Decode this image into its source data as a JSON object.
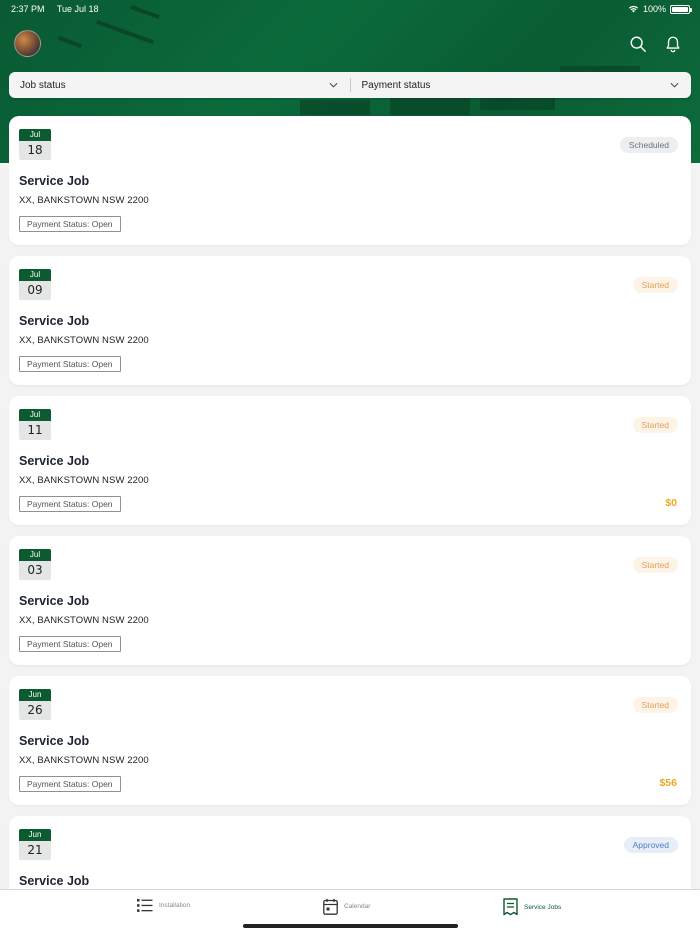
{
  "status_bar": {
    "time": "2:37 PM",
    "date": "Tue Jul 18",
    "battery": "100%"
  },
  "filters": {
    "job_status": "Job status",
    "payment_status": "Payment status"
  },
  "jobs": [
    {
      "month": "Jul",
      "day": "18",
      "status": "Scheduled",
      "status_color": "#6b7280",
      "status_bg": "#eceef0",
      "title": "Service Job",
      "address": "XX, BANKSTOWN NSW 2200",
      "payment": "Payment Status: Open",
      "amount": ""
    },
    {
      "month": "Jul",
      "day": "09",
      "status": "Started",
      "status_color": "#e0a05a",
      "status_bg": "#fdf3e6",
      "title": "Service Job",
      "address": "XX, BANKSTOWN NSW 2200",
      "payment": "Payment Status: Open",
      "amount": ""
    },
    {
      "month": "Jul",
      "day": "11",
      "status": "Started",
      "status_color": "#e0a05a",
      "status_bg": "#fdf3e6",
      "title": "Service Job",
      "address": "XX, BANKSTOWN NSW 2200",
      "payment": "Payment Status: Open",
      "amount": "$0"
    },
    {
      "month": "Jul",
      "day": "03",
      "status": "Started",
      "status_color": "#e0a05a",
      "status_bg": "#fdf3e6",
      "title": "Service Job",
      "address": "XX, BANKSTOWN NSW 2200",
      "payment": "Payment Status: Open",
      "amount": ""
    },
    {
      "month": "Jun",
      "day": "26",
      "status": "Started",
      "status_color": "#e0a05a",
      "status_bg": "#fdf3e6",
      "title": "Service Job",
      "address": "XX, BANKSTOWN NSW 2200",
      "payment": "Payment Status: Open",
      "amount": "$56"
    },
    {
      "month": "Jun",
      "day": "21",
      "status": "Approved",
      "status_color": "#4a7fc1",
      "status_bg": "#e7eef8",
      "title": "Service Job",
      "address": "",
      "payment": "",
      "amount": ""
    }
  ],
  "tabs": {
    "installation": "Installation",
    "calendar": "Calendar",
    "service_jobs": "Service Jobs"
  },
  "colors": {
    "brand": "#0b5a30",
    "amount": "#f0a623"
  }
}
